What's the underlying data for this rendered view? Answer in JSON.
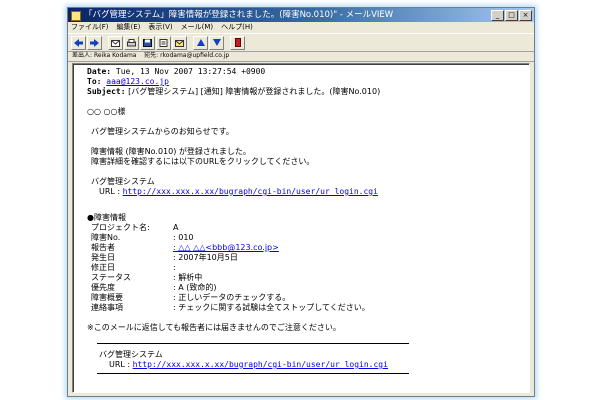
{
  "window": {
    "title": "「バグ管理システム」障害情報が登録されました。(障害No.010)\" - メールVIEW"
  },
  "menu": [
    "ファイル(F)",
    "編集(E)",
    "表示(V)",
    "メール(M)",
    "ヘルプ(H)"
  ],
  "address": {
    "from_label": "差出人:",
    "from": "Reika Kodama",
    "to_label": "宛先:",
    "to": "rkodama@upfield.co.jp"
  },
  "headers": {
    "date_label": "Date:",
    "date": "Tue, 13 Nov 2007 13:27:54 +0900",
    "to_label": "To:",
    "to": "aaa@123.co.jp",
    "subject_label": "Subject:",
    "subject": "[バグ管理システム] [通知] 障害情報が登録されました。(障害No.010)"
  },
  "greeting": "○○ ○○様",
  "intro": "バグ管理システムからのお知らせです。",
  "notice": [
    "障害情報 (障害No.010) が登録されました。",
    "障害詳細を確認するには以下のURLをクリックしてください。"
  ],
  "system": {
    "name": "バグ管理システム",
    "url_label": "URL :",
    "url": "http://xxx.xxx.x.xx/bugraph/cgi-bin/user/ur_login.cgi"
  },
  "section_title": "●障害情報",
  "fields": [
    {
      "label": "プロジェクト名:",
      "value": "A"
    },
    {
      "label": "障害No.",
      "value": ":  010"
    },
    {
      "label": "報告者",
      "value": ":  △△ △△<bbb@123.co.jp>"
    },
    {
      "label": "発生日",
      "value": ":  2007年10月5日"
    },
    {
      "label": "修正日",
      "value": ":"
    },
    {
      "label": "ステータス",
      "value": ":  解析中"
    },
    {
      "label": "優先度",
      "value": ":  A (致命的)"
    },
    {
      "label": "障害概要",
      "value": ":  正しいデータのチェックする。"
    },
    {
      "label": "連絡事項",
      "value": ":  チェックに関する試験は全てストップしてください。"
    }
  ],
  "caution": "※このメールに返信しても報告者には届きませんのでご注意ください。",
  "footer": {
    "name": "バグ管理システム",
    "url_label": "URL :",
    "url": "http://xxx.xxx.x.xx/bugraph/cgi-bin/user/ur_login.cgi"
  }
}
